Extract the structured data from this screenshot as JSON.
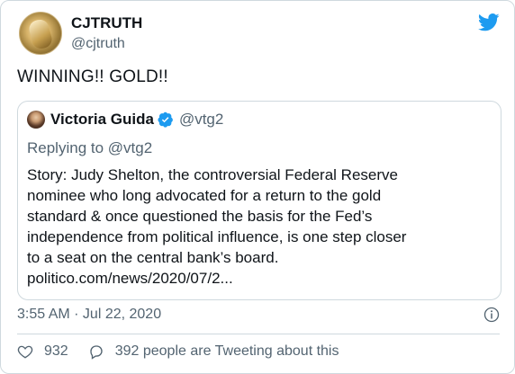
{
  "tweet": {
    "author": {
      "display_name": "CJTRUTH",
      "handle": "@cjtruth",
      "avatar_icon": "gold-coin-avatar"
    },
    "text": "WINNING!! GOLD!!",
    "brand_icon": "twitter-bird-icon",
    "brand_color": "#1d9bf0",
    "quoted": {
      "author": {
        "display_name": "Victoria Guida",
        "handle": "@vtg2",
        "verified": true,
        "verified_color": "#1d9bf0"
      },
      "replying_to_prefix": "Replying to",
      "replying_to_handle": "@vtg2",
      "body": "Story: Judy Shelton, the controversial Federal Reserve\nnominee who long advocated for a return to the gold\nstandard & once questioned the basis for the Fed’s\nindependence from political influence, is one step closer\nto a seat on the central bank’s board.\npolitico.com/news/2020/07/2..."
    },
    "timestamp": "3:55 AM · Jul 22, 2020",
    "info_icon": "info-icon",
    "likes_count": "932",
    "conversation_text": "392 people are Tweeting about this"
  }
}
